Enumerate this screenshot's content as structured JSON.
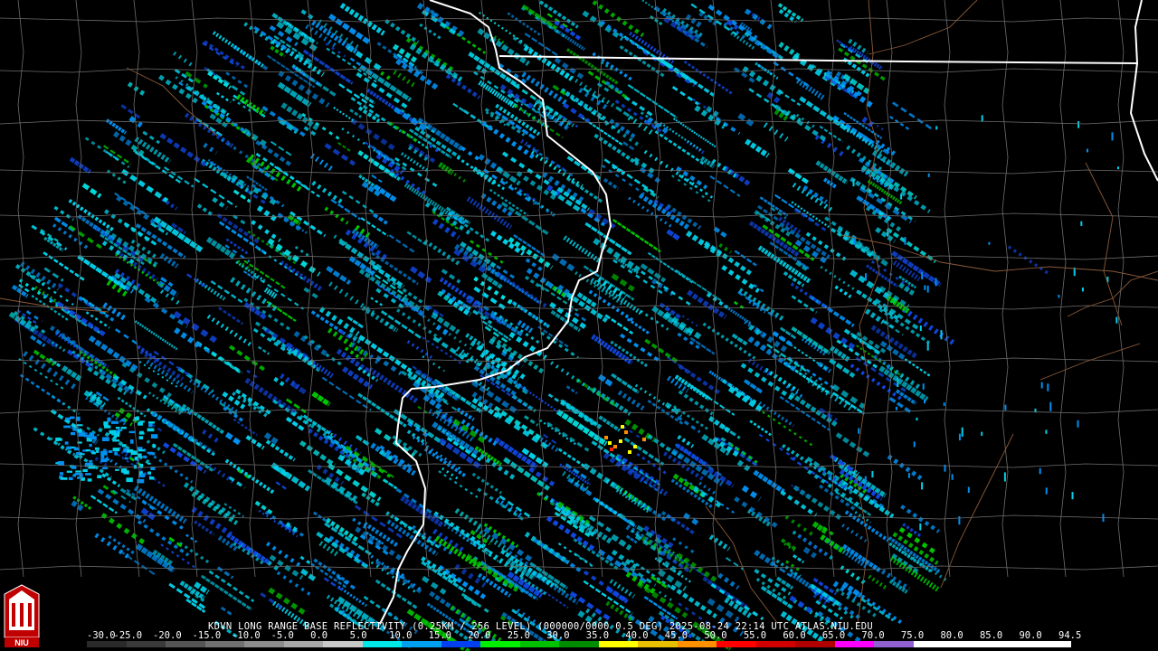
{
  "product": {
    "title": "KDVN LONG RANGE BASE REFLECTIVITY (0.25KM / 256 LEVEL) (000000/0000 0.5 DEG) 2025-08-24 22:14 UTC  ATLAS.NIU.EDU"
  },
  "logo": {
    "text": "NIU"
  },
  "legend": {
    "labels": [
      "-30.0",
      "-25.0",
      "-20.0",
      "-15.0",
      "-10.0",
      "-5.0",
      "0.0",
      "5.0",
      "10.0",
      "15.0",
      "20.0",
      "25.0",
      "30.0",
      "35.0",
      "40.0",
      "45.0",
      "50.0",
      "55.0",
      "60.0",
      "65.0",
      "70.0",
      "75.0",
      "80.0",
      "85.0",
      "90.0",
      "94.5"
    ],
    "colors": [
      "#2a2a2a",
      "#3a3a3a",
      "#555555",
      "#707070",
      "#8c8c8c",
      "#a8a8a8",
      "#c8c8c8",
      "#00e8e8",
      "#00a0f0",
      "#0040f0",
      "#00f000",
      "#00c000",
      "#008c00",
      "#ffff00",
      "#e8c000",
      "#ff9000",
      "#ff0000",
      "#d00000",
      "#b00000",
      "#ff00ff",
      "#9060d0",
      "#ffffff",
      "#ffffff",
      "#ffffff",
      "#ffffff"
    ]
  },
  "map": {
    "radar_site": "KDVN",
    "echo_colors": [
      "#00d0e8",
      "#0090f0",
      "#1048e0",
      "#00c800",
      "#00e0e0"
    ],
    "hot_colors": [
      "#ffff00",
      "#ff8c00",
      "#ff2000"
    ]
  }
}
